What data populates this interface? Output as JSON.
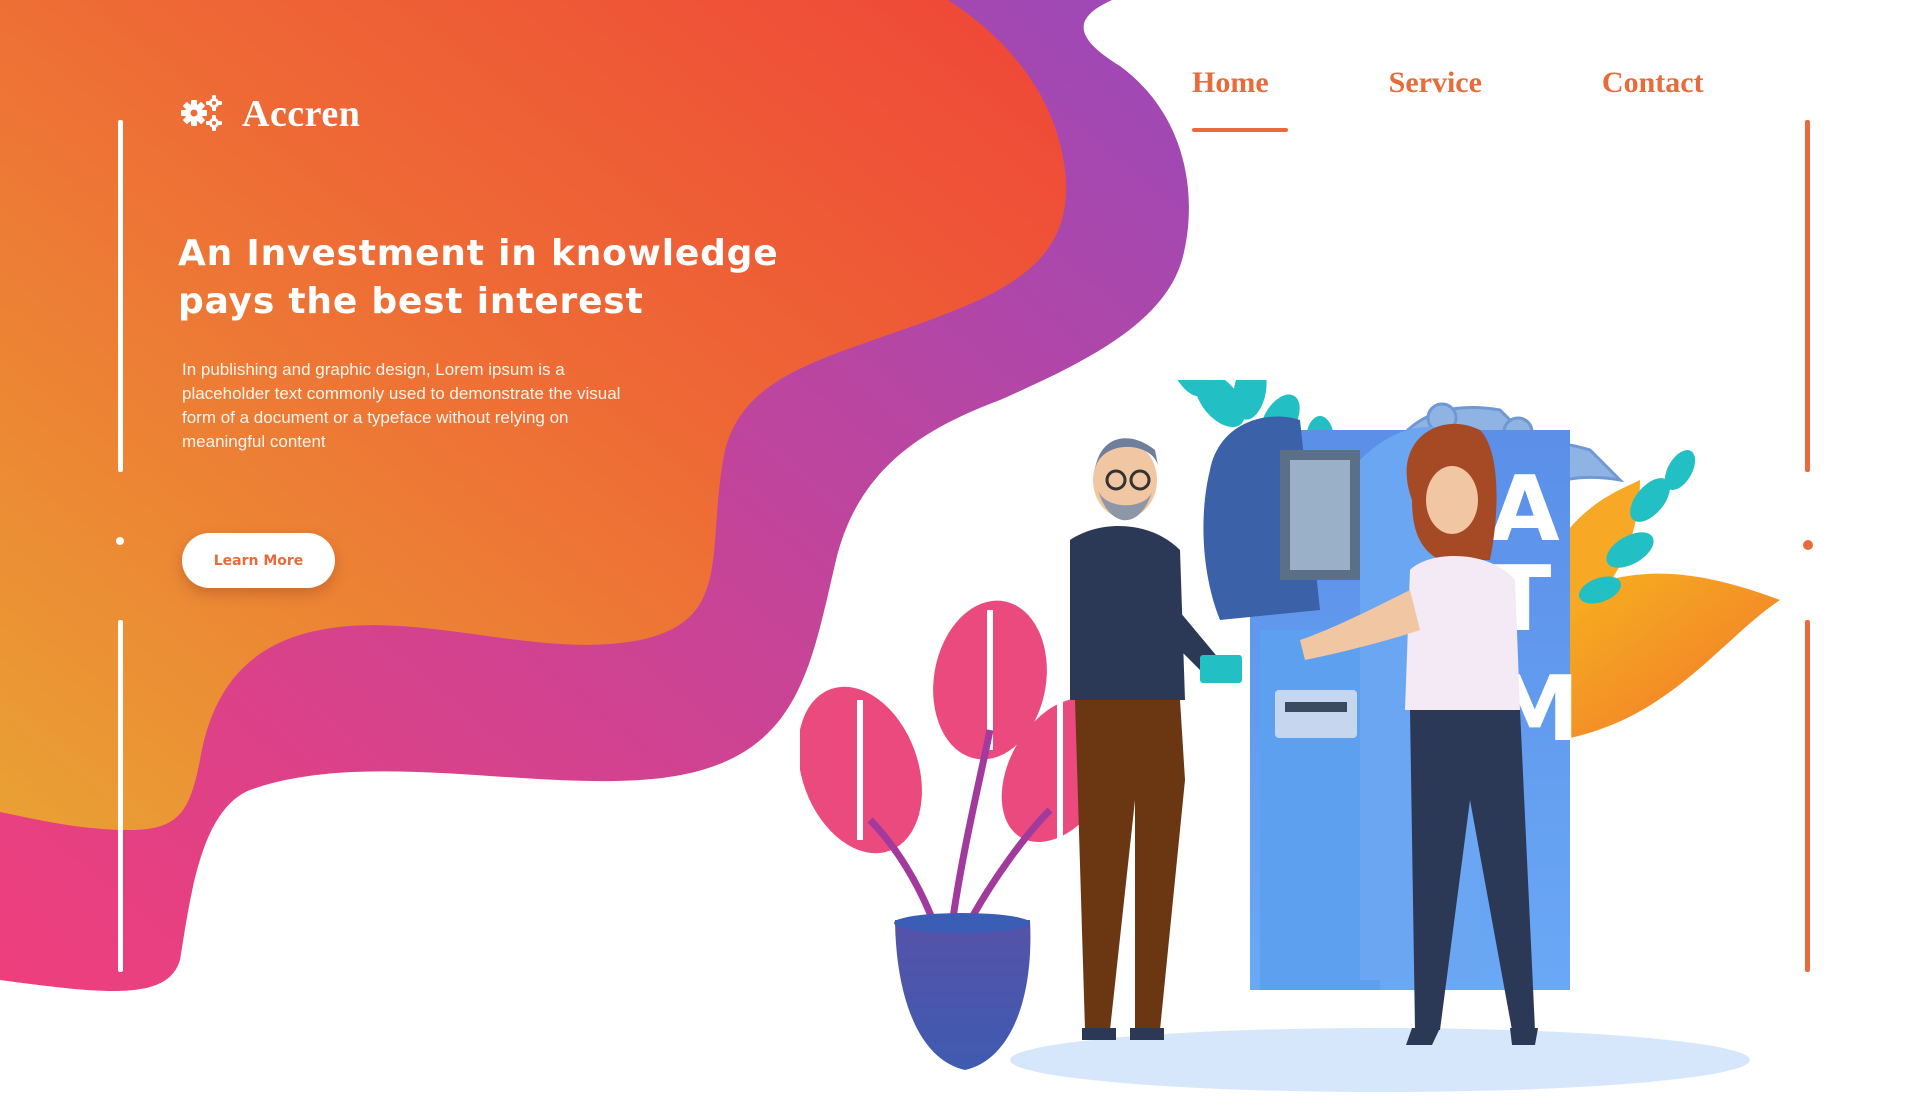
{
  "brand": {
    "name": "Accren",
    "icon": "gears-icon"
  },
  "nav": {
    "items": [
      {
        "label": "Home",
        "active": true
      },
      {
        "label": "Service",
        "active": false
      },
      {
        "label": "Contact",
        "active": false
      }
    ]
  },
  "hero": {
    "headline_line1": "An Investment in knowledge",
    "headline_line2": "pays the best interest",
    "body": "In publishing and graphic design, Lorem ipsum is a placeholder text commonly used to demonstrate the visual form of a document or a typeface without relying on meaningful content",
    "cta_label": "Learn More"
  },
  "illustration": {
    "atm_letters": [
      "A",
      "T",
      "M"
    ],
    "icons": [
      "plant-icon",
      "money-icon",
      "credit-card-icon",
      "person-icon"
    ]
  },
  "colors": {
    "accent": "#e96a3a",
    "blob_orange": "#ee6a35",
    "blob_red": "#ef4538",
    "blob_purple": "#9b49b8",
    "blob_pink": "#ef3f7c",
    "blob_yellow": "#eaa134"
  }
}
